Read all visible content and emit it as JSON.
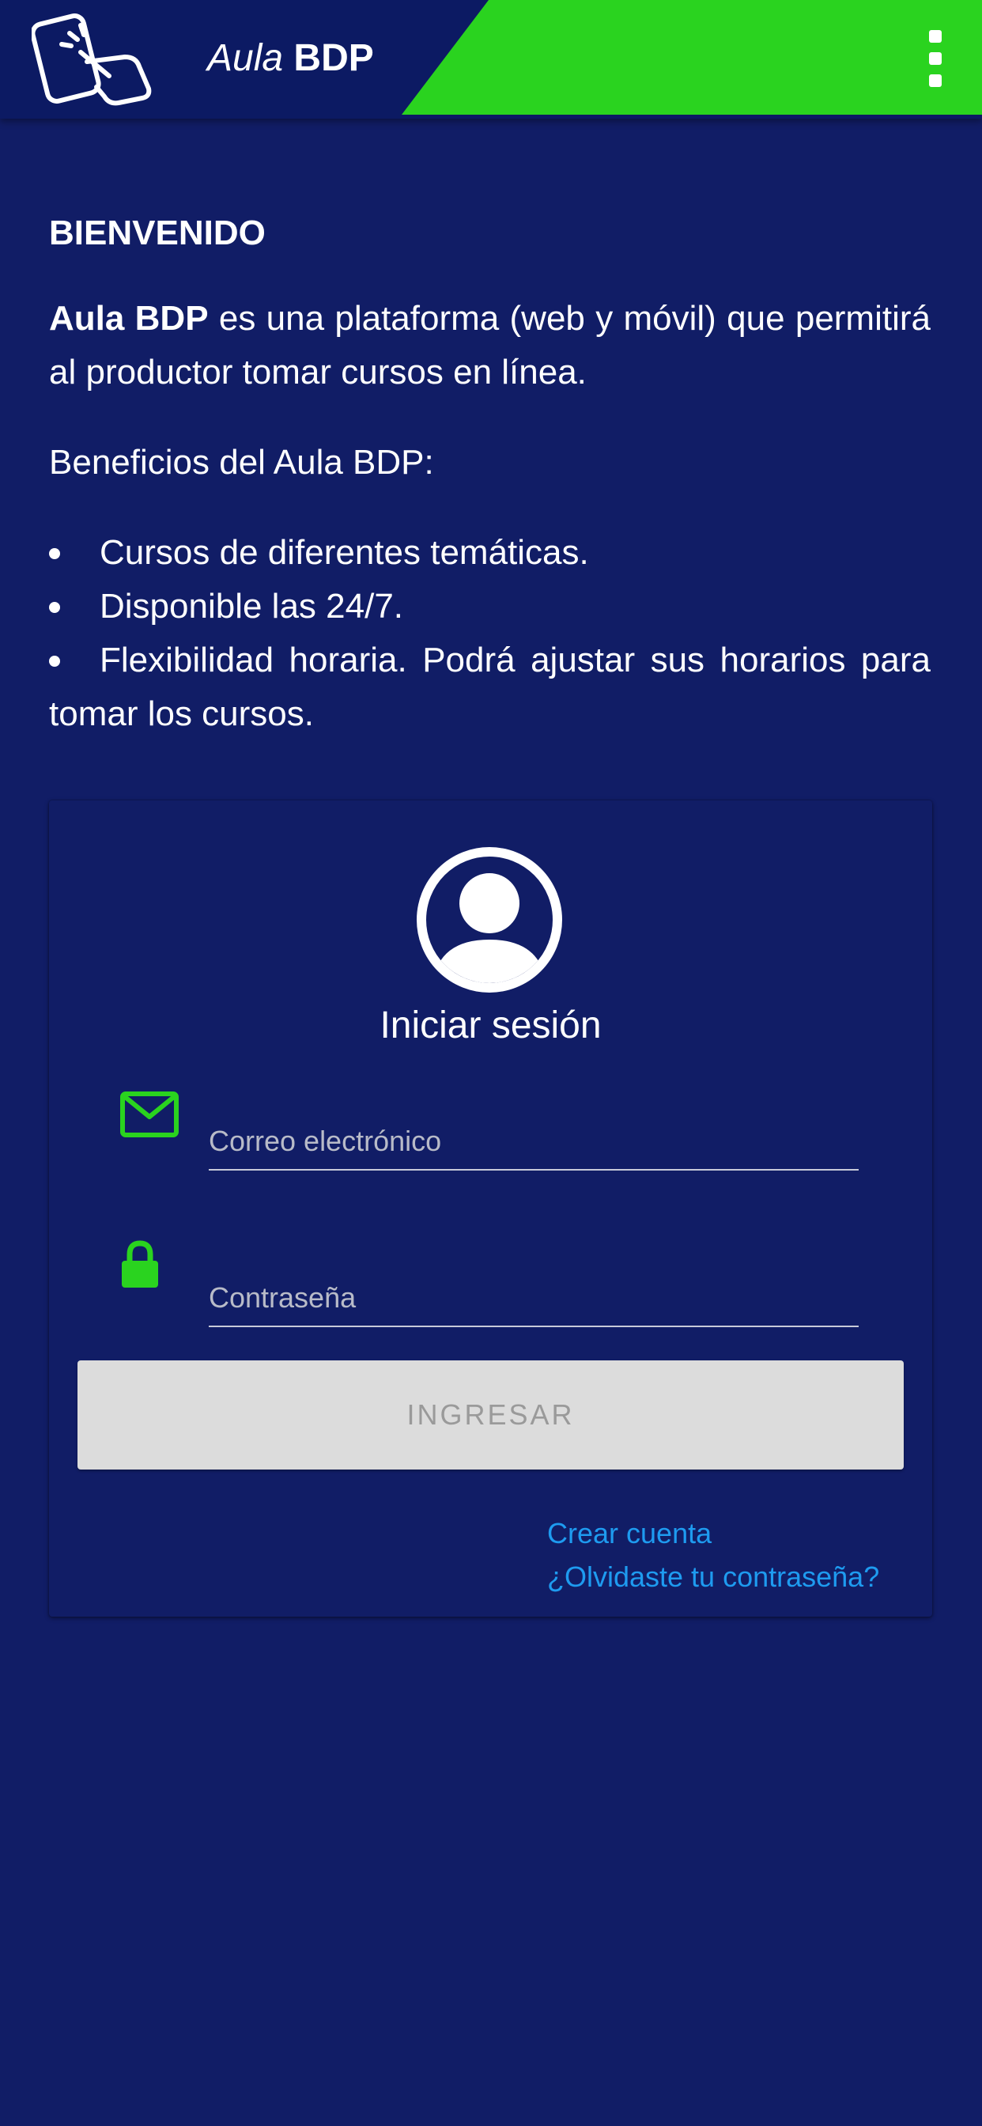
{
  "header": {
    "logo_icon": "phone-touch-icon",
    "brand_aula": "Aula",
    "brand_bdp": "BDP",
    "menu_icon": "more-vertical-icon",
    "colors": {
      "header_bg": "#0c1a63",
      "accent_green": "#2ad31f"
    }
  },
  "intro": {
    "title": "BIENVENIDO",
    "para_strong": "Aula BDP",
    "para_rest": " es una plataforma (web y móvil) que permitirá al productor tomar cursos en línea.",
    "benefits_title": "Beneficios del Aula BDP:",
    "benefits": [
      "Cursos de diferentes temáticas.",
      "Disponible las 24/7.",
      "Flexibilidad horaria. Podrá ajustar sus horarios para tomar los cursos."
    ]
  },
  "login": {
    "avatar_icon": "user-avatar-icon",
    "title": "Iniciar sesión",
    "email": {
      "icon": "envelope-icon",
      "placeholder": "Correo electrónico",
      "value": ""
    },
    "password": {
      "icon": "lock-icon",
      "placeholder": "Contraseña",
      "value": ""
    },
    "submit_label": "INGRESAR",
    "create_account_link": "Crear cuenta",
    "forgot_password_link": "¿Olvidaste tu contraseña?"
  },
  "colors": {
    "page_bg": "#111d66",
    "link": "#1e9bf0",
    "icon_green": "#2ad31f",
    "button_disabled_bg": "#dcdcdc",
    "button_disabled_text": "#9a9a9a"
  }
}
